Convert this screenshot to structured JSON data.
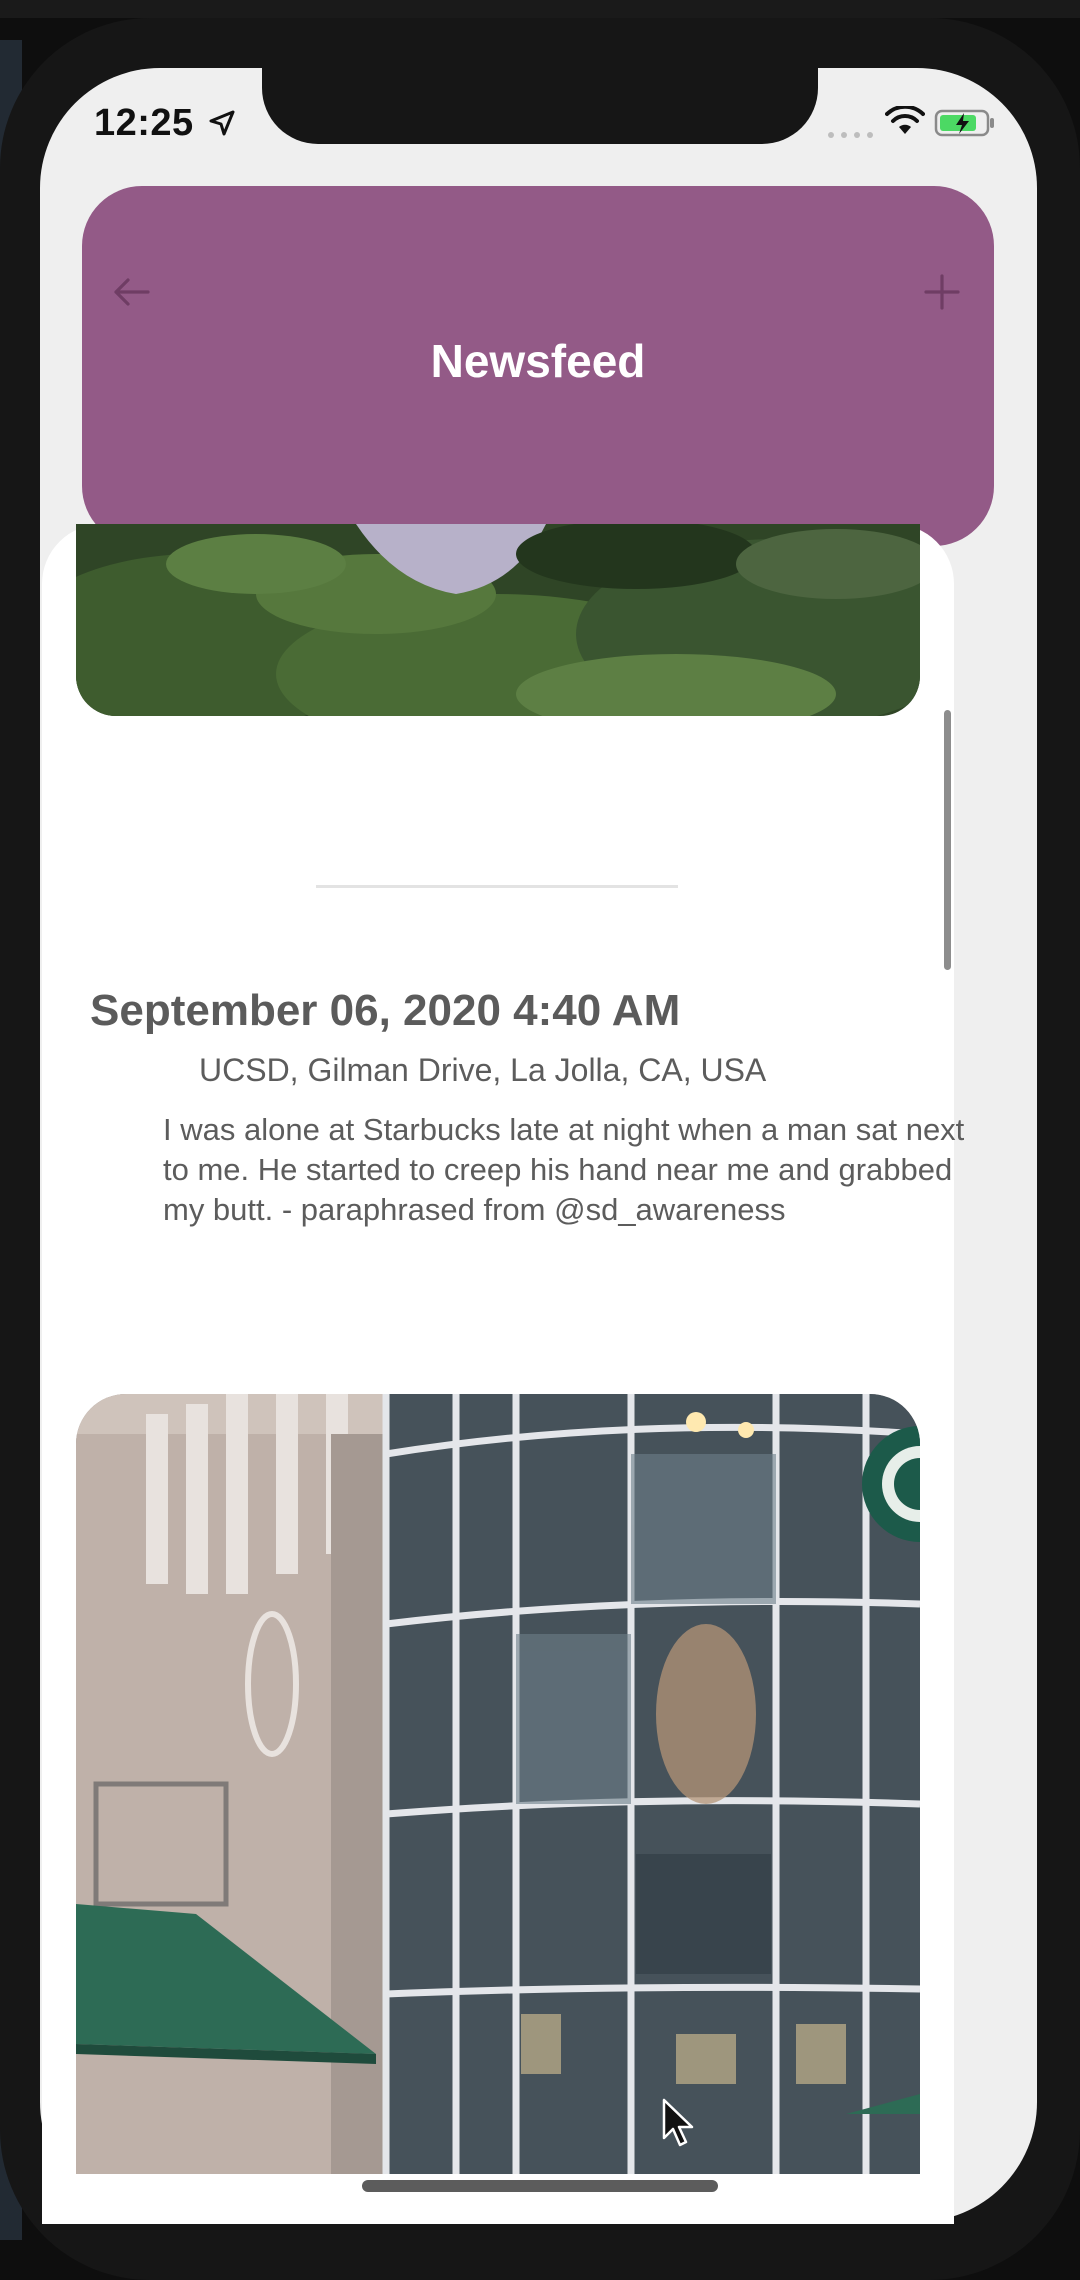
{
  "status_bar": {
    "time": "12:25",
    "location_icon": "location-arrow-icon",
    "wifi_icon": "wifi-icon",
    "battery_icon": "battery-charging-icon",
    "battery_color": "#4cd964"
  },
  "header": {
    "title": "Newsfeed",
    "back_icon": "arrow-left-icon",
    "add_icon": "plus-icon",
    "background_color": "#935a87"
  },
  "posts": [
    {
      "date": "September 06, 2020 4:40 AM",
      "location": "UCSD, Gilman Drive, La Jolla, CA, USA",
      "text": "I was alone at Starbucks late at night when a man sat next to me. He started to creep his hand near me and grabbed my butt. - paraphrased from @sd_awareness"
    }
  ]
}
